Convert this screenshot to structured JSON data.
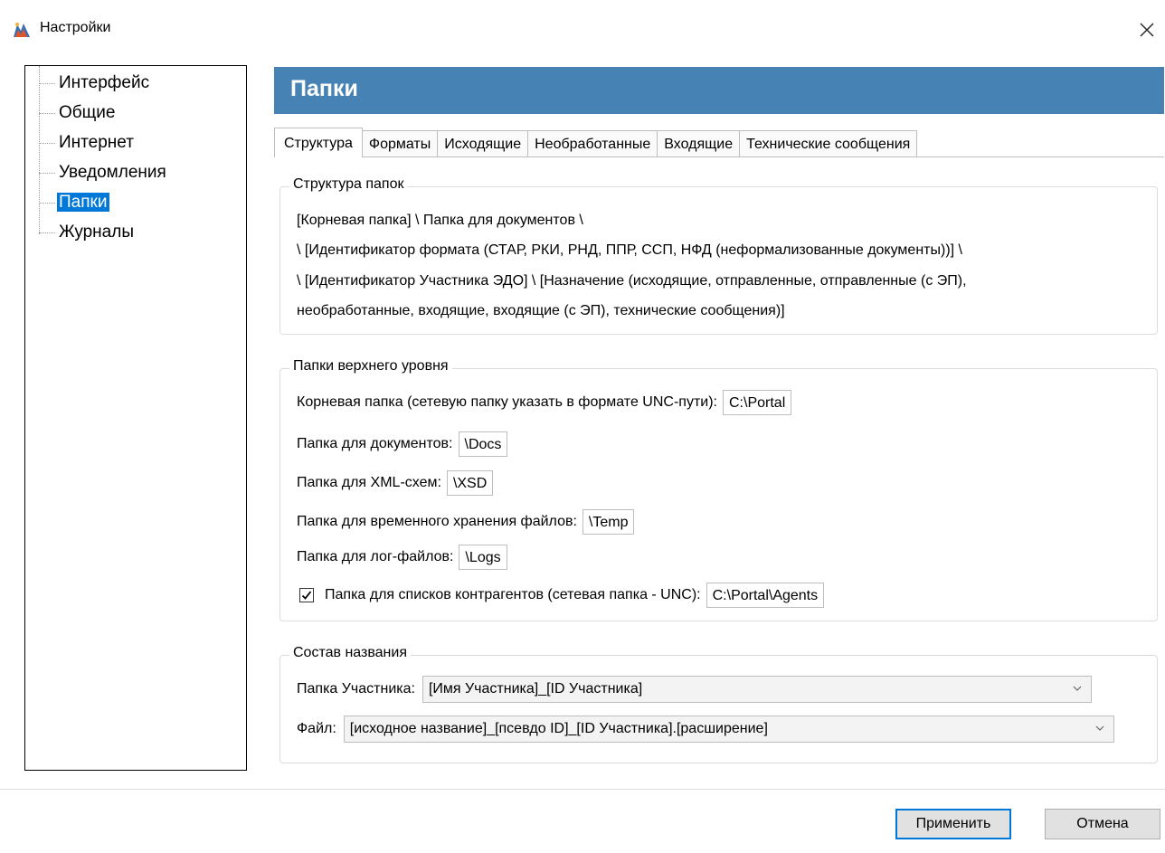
{
  "window": {
    "title": "Настройки"
  },
  "sidebar": {
    "items": [
      {
        "label": "Интерфейс"
      },
      {
        "label": "Общие"
      },
      {
        "label": "Интернет"
      },
      {
        "label": "Уведомления"
      },
      {
        "label": "Папки",
        "selected": true
      },
      {
        "label": "Журналы"
      }
    ]
  },
  "header": {
    "title": "Папки",
    "color": "#4682b4"
  },
  "tabs": [
    {
      "label": "Структура",
      "active": true
    },
    {
      "label": "Форматы"
    },
    {
      "label": "Исходящие"
    },
    {
      "label": "Необработанные"
    },
    {
      "label": "Входящие"
    },
    {
      "label": "Технические сообщения"
    }
  ],
  "structure": {
    "title": "Структура папок",
    "lines": [
      "[Корневая папка] \\ Папка для документов \\",
      "\\ [Идентификатор формата (СТАР, РКИ, РНД, ППР, ССП, НФД (неформализованные документы))] \\",
      "\\ [Идентификатор Участника ЭДО] \\ [Назначение (исходящие, отправленные, отправленные (с ЭП),",
      "необработанные, входящие, входящие (с ЭП), технические сообщения)]"
    ]
  },
  "top_folders": {
    "title": "Папки верхнего уровня",
    "root": {
      "label": "Корневая папка (сетевую папку указать в формате UNC-пути):",
      "value": "C:\\Portal"
    },
    "docs": {
      "label": "Папка для документов:",
      "value": "\\Docs"
    },
    "xml": {
      "label": "Папка для XML-схем:",
      "value": "\\XSD"
    },
    "temp": {
      "label": "Папка для временного хранения файлов:",
      "value": "\\Temp"
    },
    "logs": {
      "label": "Папка для лог-файлов:",
      "value": "\\Logs"
    },
    "agents": {
      "label": "Папка для списков контрагентов (сетевая папка - UNC):",
      "value": "C:\\Portal\\Agents",
      "checked": true
    }
  },
  "naming": {
    "title": "Состав названия",
    "participant": {
      "label": "Папка Участника:",
      "value": "[Имя Участника]_[ID Участника]"
    },
    "file": {
      "label": "Файл:",
      "value": "[исходное название]_[псевдо ID]_[ID Участника].[расширение]"
    }
  },
  "buttons": {
    "apply": "Применить",
    "cancel": "Отмена",
    "accent": "#0078d7"
  }
}
